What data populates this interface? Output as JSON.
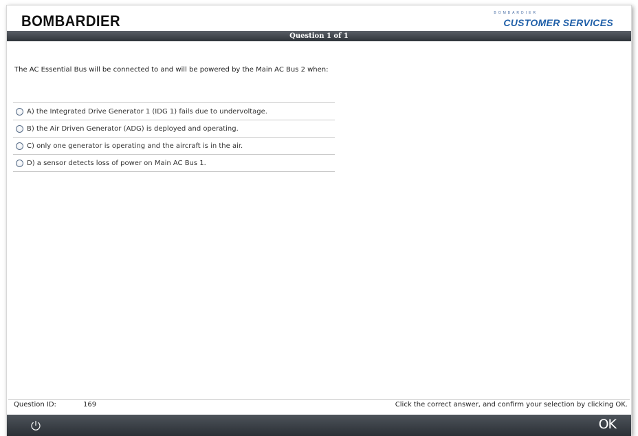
{
  "branding": {
    "left_logo": "BOMBARDIER",
    "right_logo_small": "BOMBARDIER",
    "right_logo_big": "CUSTOMER SERVICES",
    "accent_color": "#1f5fa8"
  },
  "header": {
    "title": "Question 1 of 1"
  },
  "question": {
    "text": "The AC Essential Bus will be connected to and will be powered by the Main AC Bus 2 when:",
    "answers": [
      {
        "label": "A) the Integrated Drive Generator 1 (IDG 1) fails due to undervoltage."
      },
      {
        "label": "B) the Air Driven Generator (ADG) is deployed and operating."
      },
      {
        "label": "C) only one generator is operating and the aircraft is in the air."
      },
      {
        "label": "D) a sensor detects loss of power on Main AC Bus 1."
      }
    ]
  },
  "footer": {
    "qid_label": "Question ID:",
    "qid_value": "169",
    "instruction": "Click the correct answer, and confirm your selection by clicking OK.",
    "power_icon": "power-icon",
    "ok_label": "OK"
  }
}
